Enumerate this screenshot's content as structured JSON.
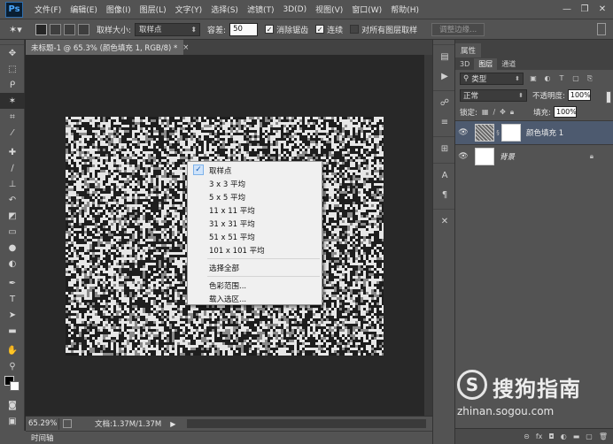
{
  "app": {
    "logo": "Ps",
    "menu": [
      "文件(F)",
      "编辑(E)",
      "图像(I)",
      "图层(L)",
      "文字(Y)",
      "选择(S)",
      "滤镜(T)",
      "3D(D)",
      "视图(V)",
      "窗口(W)",
      "帮助(H)"
    ],
    "window_controls": {
      "minimize": "—",
      "restore": "❐",
      "close": "✕"
    }
  },
  "options": {
    "sample_size_label": "取样大小:",
    "sample_size_value": "取样点",
    "tolerance_label": "容差:",
    "tolerance_value": "50",
    "antialias_label": "消除锯齿",
    "antialias_checked": true,
    "contiguous_label": "连续",
    "contiguous_checked": true,
    "all_layers_label": "对所有图层取样",
    "all_layers_checked": false,
    "refine_button": "调整边缘...",
    "check_glyph": "✓"
  },
  "document": {
    "tab_title": "未标题-1 @ 65.3% (颜色填充 1, RGB/8) *",
    "tab_close": "×",
    "zoom": "65.29%",
    "doc_size": "文档:1.37M/1.37M",
    "status_arrow": "▶",
    "timeline_label": "时间轴"
  },
  "context_menu": {
    "items": [
      {
        "label": "取样点",
        "checked": true
      },
      {
        "label": "3 x 3 平均"
      },
      {
        "label": "5 x 5 平均"
      },
      {
        "label": "11 x 11 平均"
      },
      {
        "label": "31 x 31 平均"
      },
      {
        "label": "51 x 51 平均"
      },
      {
        "label": "101 x 101 平均"
      },
      {
        "label": "选择全部"
      },
      {
        "label": "色彩范围..."
      },
      {
        "label": "载入选区..."
      }
    ]
  },
  "panels": {
    "properties_tab": "属性",
    "layers_tabs": [
      "3D",
      "图层",
      "通道"
    ],
    "filter_kind": "类型",
    "blend_mode": "正常",
    "opacity_label": "不透明度:",
    "opacity_value": "100%",
    "lock_label": "锁定:",
    "fill_label": "填充:",
    "fill_value": "100%",
    "layers": [
      {
        "name": "颜色填充 1",
        "selected": true
      },
      {
        "name": "背景",
        "locked": true
      }
    ],
    "footer_icons": [
      "link-icon",
      "fx-icon",
      "mask-icon",
      "adjustment-icon",
      "group-icon",
      "new-layer-icon",
      "trash-icon"
    ]
  },
  "watermark": {
    "brand": "搜狗指南",
    "url": "zhinan.sogou.com"
  },
  "icons": {
    "tools": [
      "move-icon",
      "marquee-icon",
      "lasso-icon",
      "magic-wand-icon",
      "crop-icon",
      "eyedropper-icon",
      "healing-icon",
      "brush-icon",
      "stamp-icon",
      "history-brush-icon",
      "eraser-icon",
      "gradient-icon",
      "blur-icon",
      "dodge-icon",
      "pen-icon",
      "type-icon",
      "path-select-icon",
      "shape-icon",
      "hand-icon",
      "zoom-icon"
    ]
  }
}
